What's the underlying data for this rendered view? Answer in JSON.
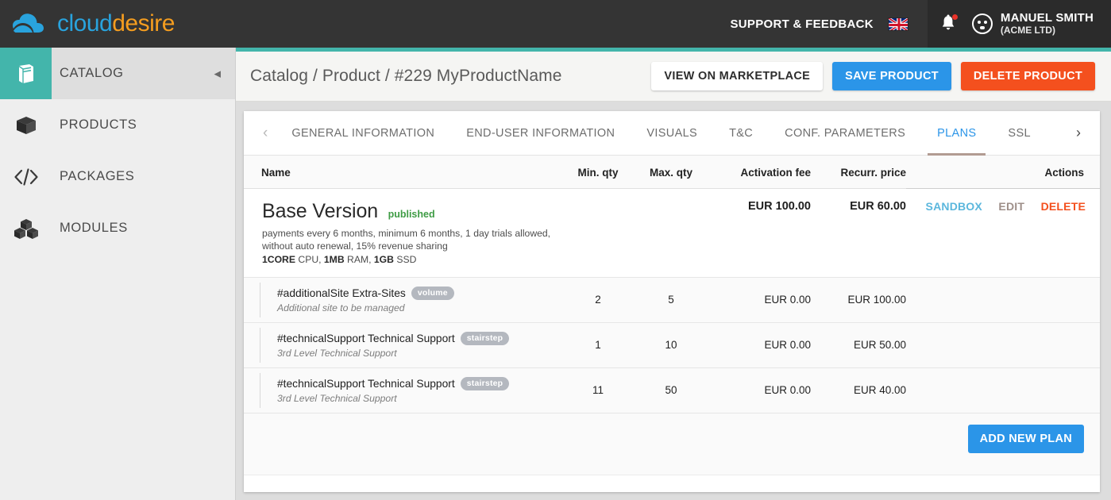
{
  "header": {
    "logo_text_1": "cloud",
    "logo_text_2": "desire",
    "support_label": "SUPPORT & FEEDBACK",
    "language_flag": "uk-flag-icon",
    "notifications_icon": "bell-icon",
    "avatar_icon": "avatar-icon",
    "user_name": "MANUEL SMITH",
    "user_org": "(ACME LTD)",
    "bg_color": "#343434",
    "accent_teal": "#43b5ab"
  },
  "sidebar": {
    "items": [
      {
        "label": "CATALOG",
        "icon": "book-icon",
        "active": true
      },
      {
        "label": "PRODUCTS",
        "icon": "box-icon",
        "active": false
      },
      {
        "label": "PACKAGES",
        "icon": "code-icon",
        "active": false
      },
      {
        "label": "MODULES",
        "icon": "cubes-icon",
        "active": false
      }
    ],
    "collapse_glyph": "◀"
  },
  "titlebar": {
    "breadcrumb": "Catalog / Product / #229 MyProductName",
    "view_marketplace_label": "VIEW ON MARKETPLACE",
    "save_label": "SAVE PRODUCT",
    "delete_label": "DELETE PRODUCT",
    "save_color": "#2b95e8",
    "delete_color": "#f4501e"
  },
  "tabs": {
    "prev_glyph": "‹",
    "next_glyph": "›",
    "items": [
      {
        "label": "GENERAL INFORMATION",
        "active": false
      },
      {
        "label": "END-USER INFORMATION",
        "active": false
      },
      {
        "label": "VISUALS",
        "active": false
      },
      {
        "label": "T&C",
        "active": false
      },
      {
        "label": "CONF. PARAMETERS",
        "active": false
      },
      {
        "label": "PLANS",
        "active": true
      },
      {
        "label": "SSL",
        "active": false
      }
    ],
    "active_color": "#2b95e8",
    "underline_color": "#b29b92"
  },
  "table": {
    "columns": {
      "name": "Name",
      "min_qty": "Min. qty",
      "max_qty": "Max. qty",
      "activation_fee": "Activation fee",
      "recurr_price": "Recurr. price",
      "actions": "Actions"
    },
    "plan": {
      "title": "Base Version",
      "status": "published",
      "status_color": "#3f9c45",
      "description": "payments every 6 months, minimum 6 months, 1 day trials allowed, without auto renewal, 15% revenue sharing",
      "spec_cpu_value": "1CORE",
      "spec_cpu_label": " CPU, ",
      "spec_ram_value": "1MB",
      "spec_ram_label": " RAM, ",
      "spec_ssd_value": "1GB",
      "spec_ssd_label": " SSD",
      "min_qty": "",
      "max_qty": "",
      "activation_fee": "EUR 100.00",
      "recurr_price": "EUR 60.00",
      "actions": {
        "sandbox": "SANDBOX",
        "edit": "EDIT",
        "delete": "DELETE",
        "sandbox_color": "#5bb7dd",
        "edit_color": "#9e8f89",
        "delete_color": "#f4501e"
      }
    },
    "sub_rows": [
      {
        "name": "#additionalSite Extra-Sites",
        "pill": "volume",
        "subtitle": "Additional site to be managed",
        "min_qty": "2",
        "max_qty": "5",
        "activation_fee": "EUR 0.00",
        "recurr_price": "EUR 100.00"
      },
      {
        "name": "#technicalSupport Technical Support",
        "pill": "stairstep",
        "subtitle": "3rd Level Technical Support",
        "min_qty": "1",
        "max_qty": "10",
        "activation_fee": "EUR 0.00",
        "recurr_price": "EUR 50.00"
      },
      {
        "name": "#technicalSupport Technical Support",
        "pill": "stairstep",
        "subtitle": "3rd Level Technical Support",
        "min_qty": "11",
        "max_qty": "50",
        "activation_fee": "EUR 0.00",
        "recurr_price": "EUR 40.00"
      }
    ]
  },
  "footer": {
    "add_plan_label": "ADD NEW PLAN",
    "add_plan_color": "#2b95e8"
  }
}
